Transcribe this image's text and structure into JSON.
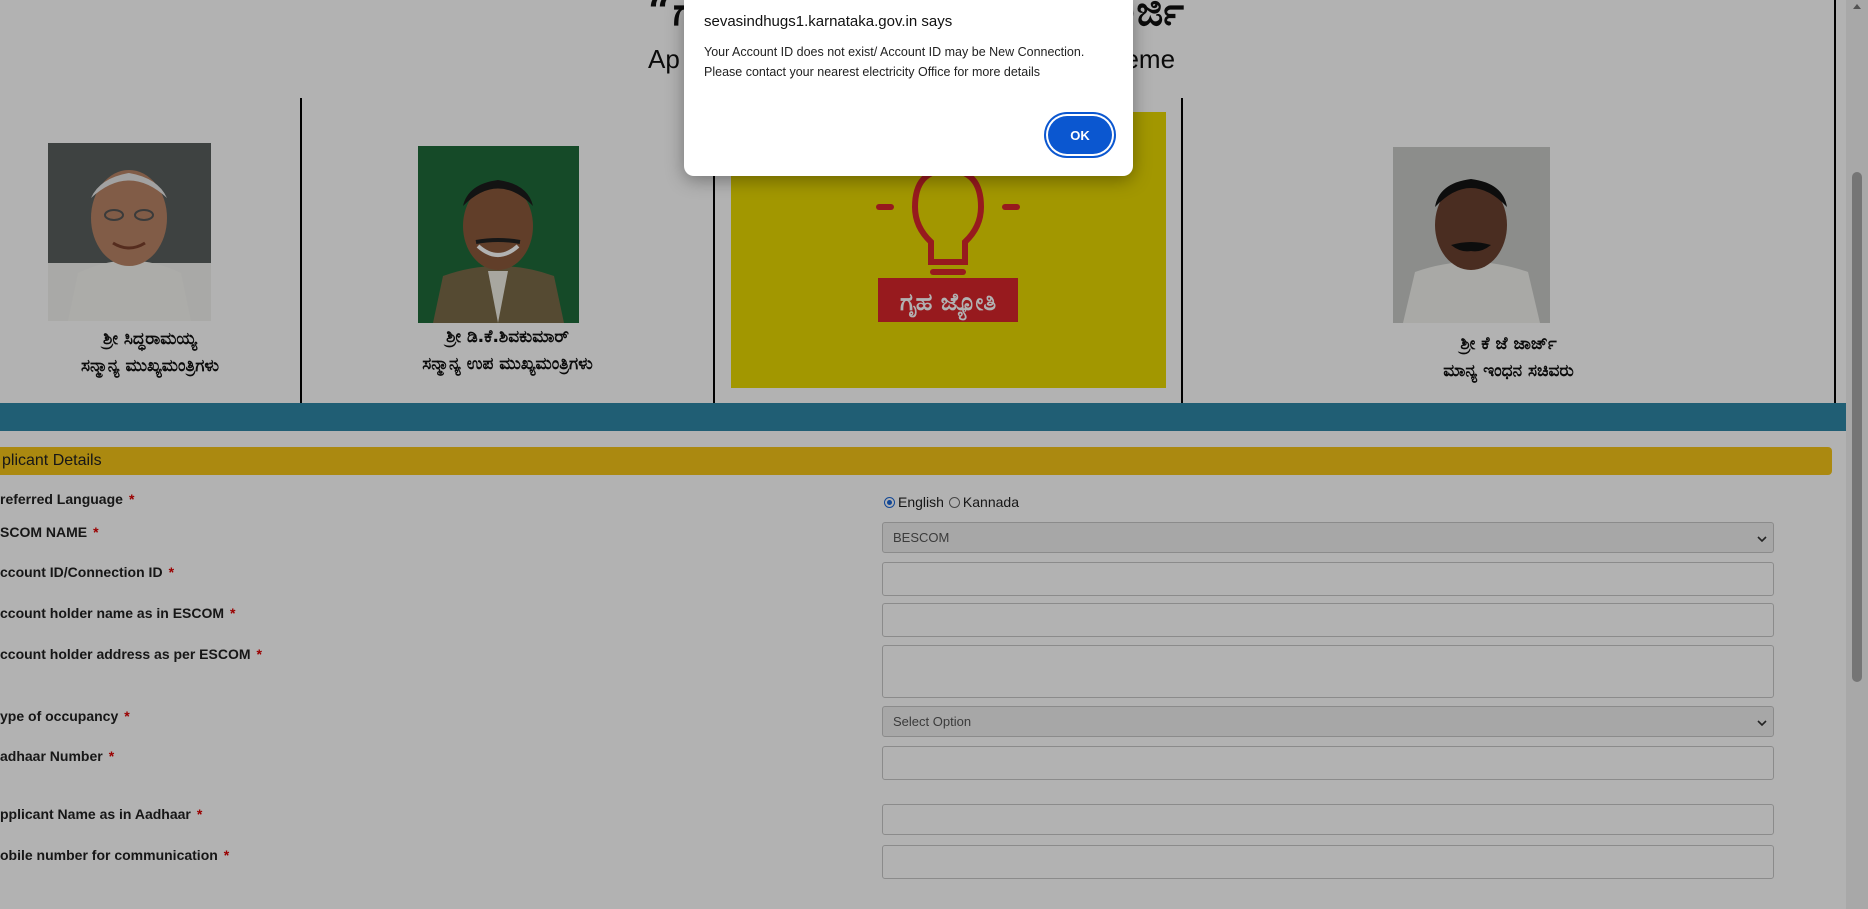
{
  "header": {
    "title_left": "“ಗ",
    "title_right": "ಅರ್ಜಿ",
    "subtitle_left": "Ap",
    "subtitle_right": "heme"
  },
  "leaders": [
    {
      "name": "ಶ್ರೀ ಸಿದ್ಧರಾಮಯ್ಯ",
      "role": "ಸನ್ಮಾನ್ಯ ಮುಖ್ಯಮಂತ್ರಿಗಳು"
    },
    {
      "name": "ಶ್ರೀ ಡಿ.ಕೆ.ಶಿವಕುಮಾರ್",
      "role": "ಸನ್ಮಾನ್ಯ ಉಪ ಮುಖ್ಯಮಂತ್ರಿಗಳು"
    },
    {
      "name": "ಶ್ರೀ ಕೆ ಜೆ ಜಾರ್ಜ್",
      "role": "ಮಾನ್ಯ ಇಂಧನ ಸಚಿವರು"
    }
  ],
  "logo": {
    "text": "ಗೃಹ ಜ್ಯೋತಿ",
    "bg_color": "#e8d900",
    "fg_color": "#d9262c"
  },
  "form": {
    "section_title": "plicant Details",
    "labels": {
      "language": "referred Language",
      "escom": "SCOM NAME",
      "account_id": "ccount ID/Connection ID",
      "holder_name": "ccount holder name as in ESCOM",
      "holder_address": "ccount holder address as per ESCOM",
      "occupancy": "ype of occupancy",
      "aadhaar": "adhaar Number",
      "applicant_name": "pplicant Name as in Aadhaar",
      "mobile": "obile number for communication"
    },
    "required_mark": "*",
    "language_options": [
      "English",
      "Kannada"
    ],
    "language_selected": "English",
    "escom_value": "BESCOM",
    "occupancy_value": "Select Option",
    "account_id_value": "",
    "holder_name_value": "",
    "holder_address_value": "",
    "aadhaar_value": "",
    "applicant_name_value": "",
    "mobile_value": ""
  },
  "dialog": {
    "title": "sevasindhugs1.karnataka.gov.in says",
    "message_line1": "Your Account ID does not exist/ Account ID may be New Connection.",
    "message_line2": "Please contact your nearest electricity Office for more details",
    "ok_label": "OK"
  },
  "colors": {
    "accent_bar": "#2f87a6",
    "section_header": "#f5c518",
    "button": "#0b57d0"
  }
}
